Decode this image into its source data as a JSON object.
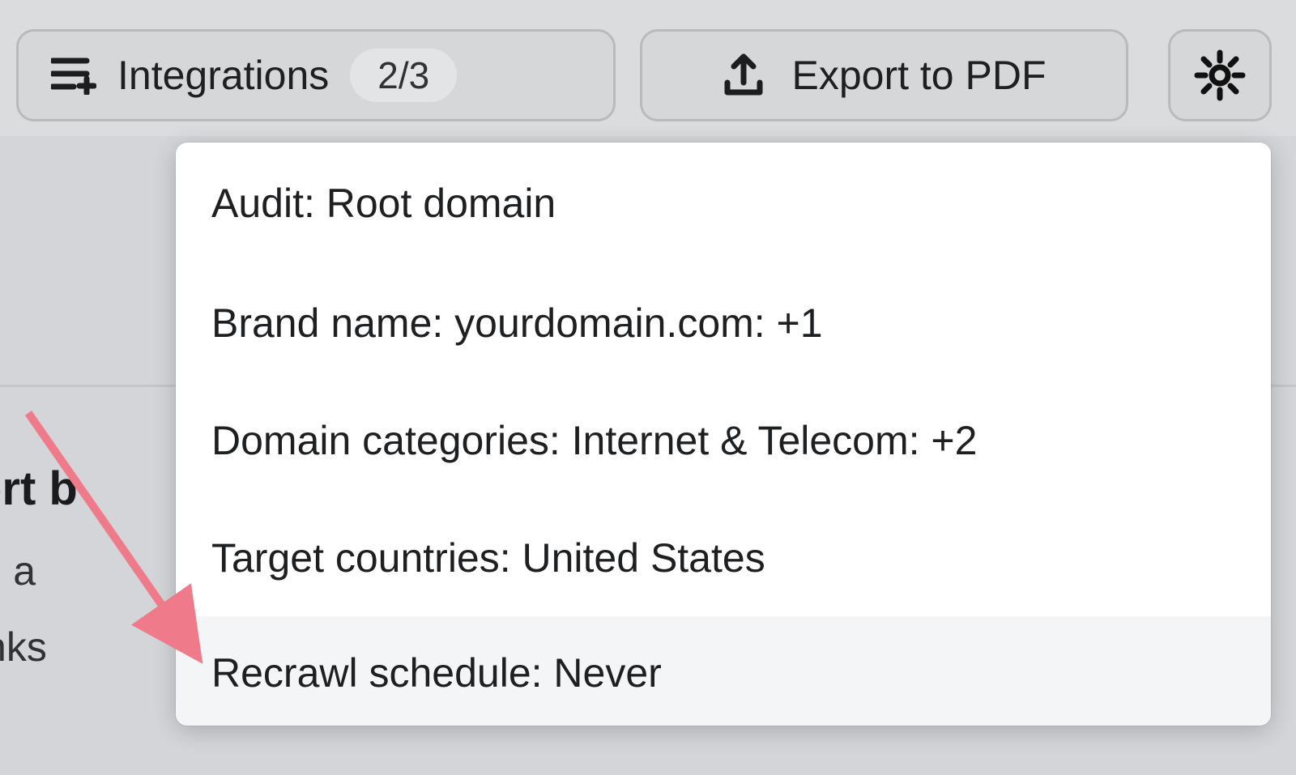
{
  "toolbar": {
    "integrations": {
      "label": "Integrations",
      "badge": "2/3"
    },
    "export": {
      "label": "Export to PDF"
    }
  },
  "background": {
    "title_fragment": "mport b",
    "line1_fragment": "pload a",
    "line2_fragment": "acklinks"
  },
  "settings_menu": {
    "items": [
      "Audit: Root domain",
      "Brand name: yourdomain.com: +1",
      "Domain categories: Internet & Telecom: +2",
      "Target countries: United States",
      "Recrawl schedule: Never"
    ],
    "hovered_index": 4
  }
}
